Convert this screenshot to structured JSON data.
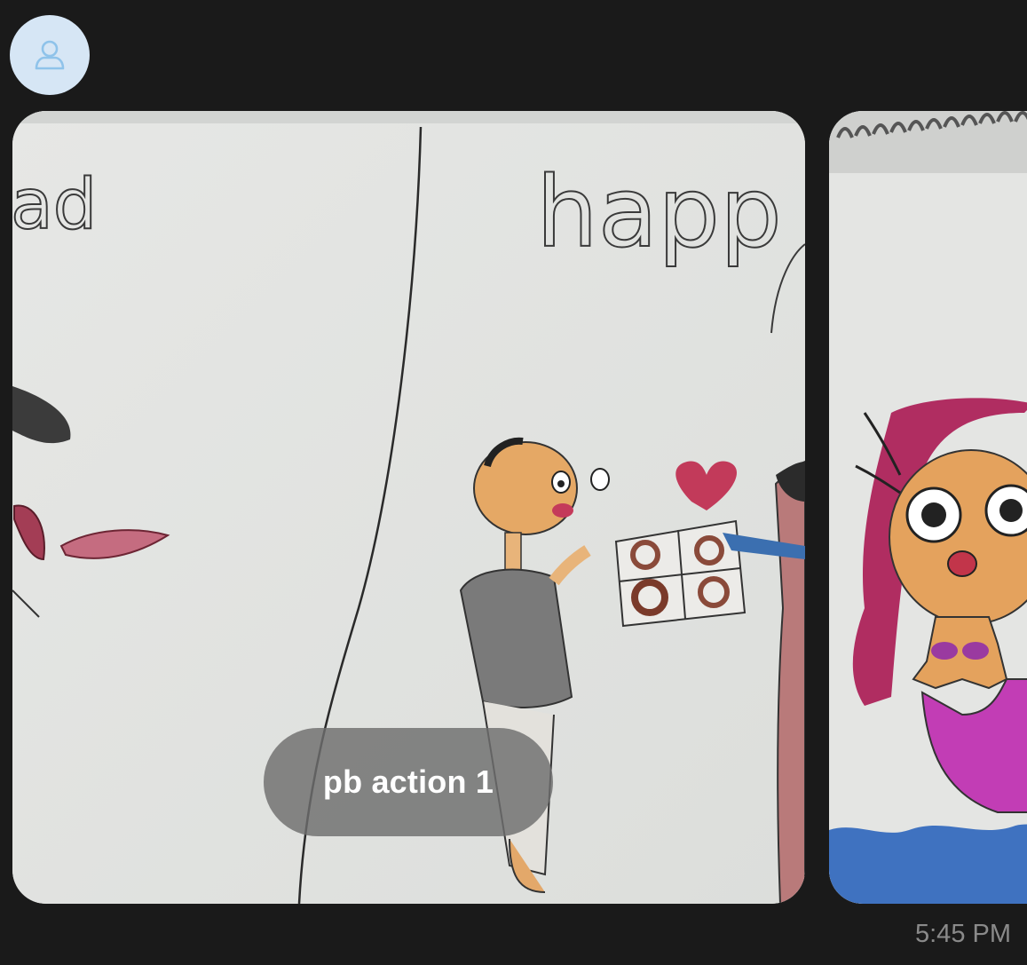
{
  "message": {
    "sender_avatar": "person-icon",
    "photos": [
      {
        "description_name": "drawing-photo-1"
      },
      {
        "description_name": "drawing-photo-2"
      }
    ],
    "action_label": "pb action 1",
    "timestamp": "5:45 PM"
  },
  "drawing_text": {
    "left_word": "ad",
    "right_word": "happ"
  },
  "colors": {
    "background": "#1a1a1a",
    "avatar_bg": "#d6e6f5",
    "avatar_icon": "#8fc3ea",
    "pill_bg": "#6e6e6e",
    "timestamp": "#8a8a8a"
  }
}
